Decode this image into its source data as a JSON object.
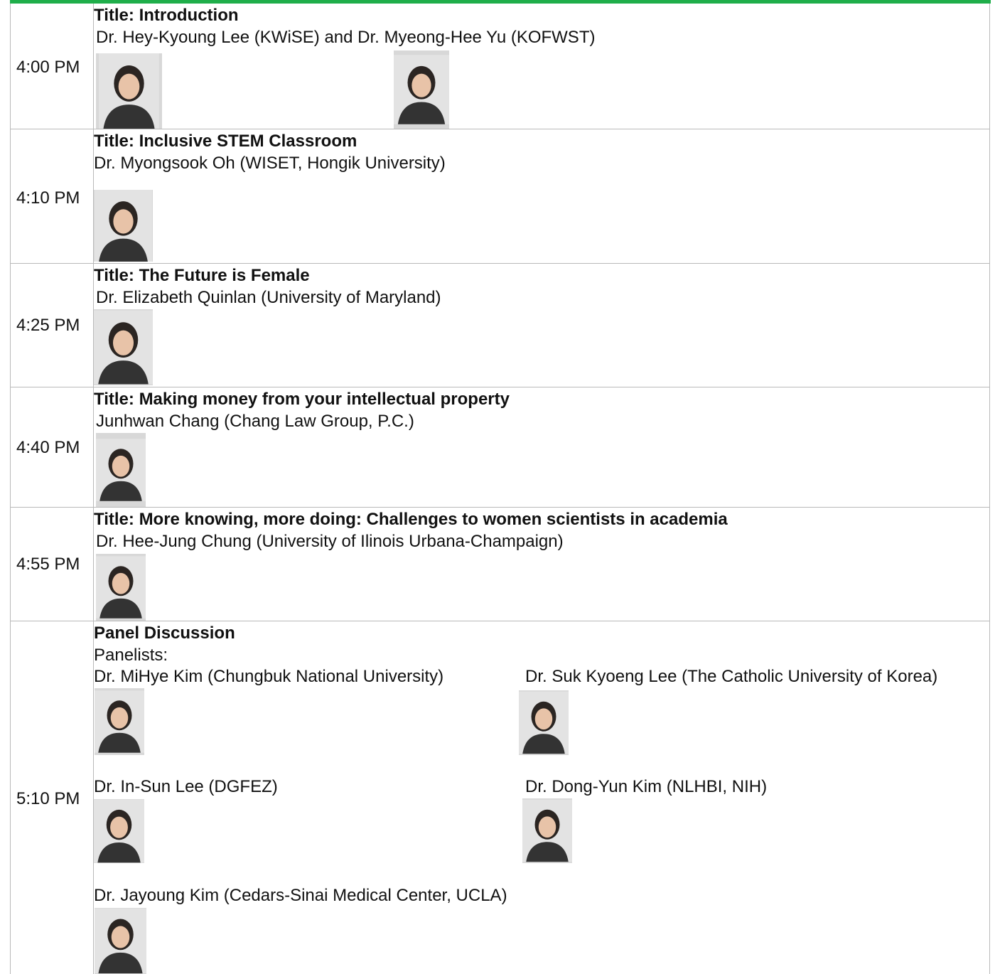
{
  "sessions": [
    {
      "time": "4:00 PM",
      "title": "Title: Introduction",
      "speakers": "Dr. Hey-Kyoung Lee (KWiSE) and Dr. Myeong-Hee Yu (KOFWST)"
    },
    {
      "time": "4:10 PM",
      "title": "Title: Inclusive STEM Classroom",
      "speakers": "Dr. Myongsook Oh (WISET, Hongik University)"
    },
    {
      "time": "4:25 PM",
      "title": "Title: The Future is Female",
      "speakers": "Dr. Elizabeth Quinlan (University of Maryland)"
    },
    {
      "time": "4:40 PM",
      "title": "Title: Making money from your intellectual property",
      "speakers": "Junhwan Chang (Chang Law Group, P.C.)"
    },
    {
      "time": "4:55 PM",
      "title": "Title: More knowing, more doing: Challenges to women scientists in academia",
      "speakers": "Dr. Hee-Jung Chung (University of Ilinois Urbana-Champaign)"
    },
    {
      "time": "5:10 PM",
      "title": "Panel Discussion",
      "panelists_label": "Panelists:",
      "panelists": [
        "Dr. MiHye Kim (Chungbuk National University)",
        "Dr. Suk Kyoeng Lee (The Catholic University of Korea)",
        "Dr. In-Sun Lee (DGFEZ)",
        "Dr. Dong-Yun Kim (NLHBI, NIH)",
        "Dr. Jayoung Kim (Cedars-Sinai Medical Center, UCLA)"
      ]
    }
  ],
  "colors": {
    "accent_bar": "#1fae4a",
    "grid_line": "#b9b9b9"
  },
  "icons": {
    "portrait": "portrait-photo-icon"
  }
}
